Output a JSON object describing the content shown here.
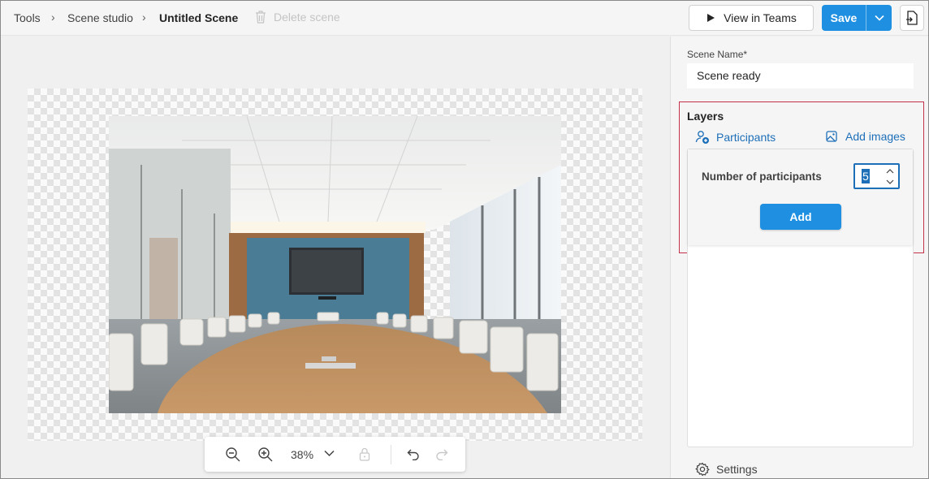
{
  "breadcrumb": {
    "items": [
      "Tools",
      "Scene studio"
    ],
    "current": "Untitled Scene",
    "separator": "›"
  },
  "toolbar": {
    "delete_label": "Delete scene",
    "view_in_teams_label": "View in Teams",
    "save_label": "Save"
  },
  "zoom": {
    "level": "38%"
  },
  "panel": {
    "scene_name_label": "Scene Name*",
    "scene_name_value": "Scene ready",
    "layers_title": "Layers",
    "tab_participants": "Participants",
    "tab_add_images": "Add images",
    "number_of_participants_label": "Number of participants",
    "participants_value": "5",
    "add_button_label": "Add",
    "settings_label": "Settings"
  },
  "colors": {
    "accent": "#1e8fe1",
    "link": "#1d6fb8",
    "highlight_border": "#c4314b"
  },
  "icons": {
    "delete": "trash-icon",
    "view": "play-icon",
    "save_menu": "chevron-down-icon",
    "export": "export-icon",
    "zoom_out": "zoom-out-icon",
    "zoom_in": "zoom-in-icon",
    "zoom_menu": "chevron-down-icon",
    "lock": "lock-icon",
    "undo": "undo-icon",
    "redo": "redo-icon",
    "participants": "person-add-icon",
    "add_images": "image-icon",
    "settings": "gear-icon"
  }
}
